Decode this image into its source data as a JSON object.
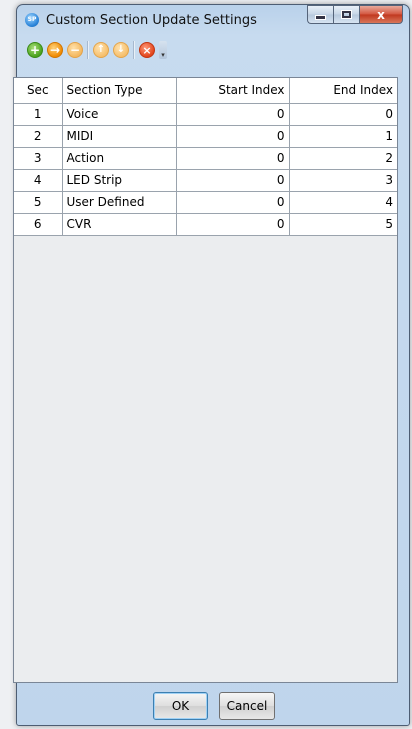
{
  "window": {
    "title": "Custom Section Update Settings",
    "app_icon_text": "SP",
    "minimize_icon": "minimize-icon",
    "maximize_icon": "maximize-icon",
    "close_icon": "close-icon",
    "close_glyph": "x"
  },
  "toolbar": {
    "items": [
      {
        "name": "add-icon",
        "glyph": "+"
      },
      {
        "name": "insert-icon",
        "glyph": "→"
      },
      {
        "name": "remove-icon",
        "glyph": "−"
      },
      {
        "name": "move-up-icon",
        "glyph": "↑"
      },
      {
        "name": "move-down-icon",
        "glyph": "↓"
      },
      {
        "name": "clear-icon",
        "glyph": "×"
      }
    ],
    "overflow_glyph": "▾"
  },
  "grid": {
    "columns": [
      "Sec",
      "Section Type",
      "Start Index",
      "End Index"
    ],
    "rows": [
      {
        "sec": "1",
        "type": "Voice",
        "start": "0",
        "end": "0"
      },
      {
        "sec": "2",
        "type": "MIDI",
        "start": "0",
        "end": "1"
      },
      {
        "sec": "3",
        "type": "Action",
        "start": "0",
        "end": "2"
      },
      {
        "sec": "4",
        "type": "LED Strip",
        "start": "0",
        "end": "3"
      },
      {
        "sec": "5",
        "type": "User Defined",
        "start": "0",
        "end": "4"
      },
      {
        "sec": "6",
        "type": "CVR",
        "start": "0",
        "end": "5"
      }
    ]
  },
  "buttons": {
    "ok": "OK",
    "cancel": "Cancel"
  }
}
